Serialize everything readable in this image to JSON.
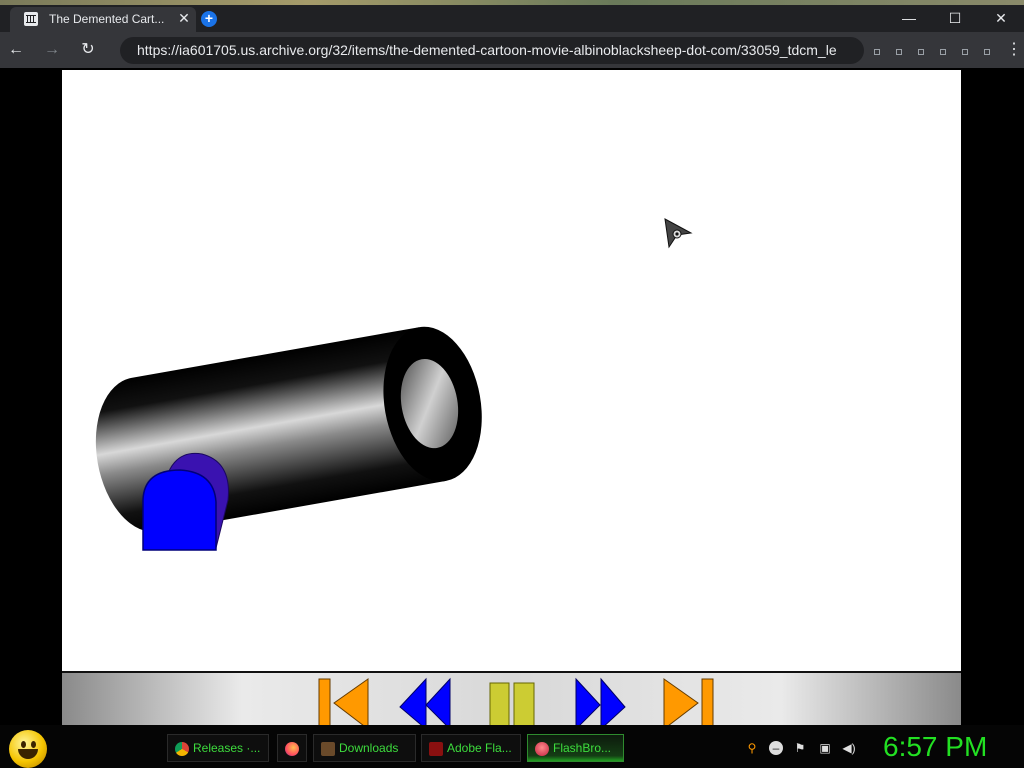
{
  "browser": {
    "tab": {
      "title": "The Demented Cart...",
      "close_glyph": "✕",
      "favicon": "archive-org-icon"
    },
    "new_tab_glyph": "+",
    "window_controls": {
      "minimize": "—",
      "maximize": "☐",
      "close": "✕"
    },
    "nav": {
      "back": "←",
      "forward": "→",
      "reload": "↻",
      "menu": "⋮"
    },
    "url": "https://ia601705.us.archive.org/32/items/the-demented-cartoon-movie-albinoblacksheep-dot-com/33059_tdcm_le"
  },
  "flash_player": {
    "stage_background": "#ffffff",
    "controls": [
      {
        "name": "rewind-to-start",
        "color": "#ff9900"
      },
      {
        "name": "step-back",
        "color": "#0000ff"
      },
      {
        "name": "pause",
        "color": "#cccc33"
      },
      {
        "name": "step-forward",
        "color": "#0000ff"
      },
      {
        "name": "skip-to-end",
        "color": "#ff9900"
      }
    ]
  },
  "taskbar": {
    "start_icon": "smiley-orb-icon",
    "items": [
      {
        "label": "Releases ·...",
        "icon": "chrome-icon"
      },
      {
        "label": "",
        "icon": "firefox-icon"
      },
      {
        "label": "Downloads",
        "icon": "folder-icon"
      },
      {
        "label": "Adobe Fla...",
        "icon": "flash-icon"
      },
      {
        "label": "FlashBro...",
        "icon": "flashbrowser-icon",
        "active": true
      }
    ],
    "tray_icons": [
      "search-icon",
      "minus-circle-icon",
      "flag-icon",
      "network-icon",
      "volume-icon"
    ],
    "clock": "6:57 PM"
  },
  "colors": {
    "accent_green": "#22e022",
    "chrome_dark": "#202124"
  }
}
